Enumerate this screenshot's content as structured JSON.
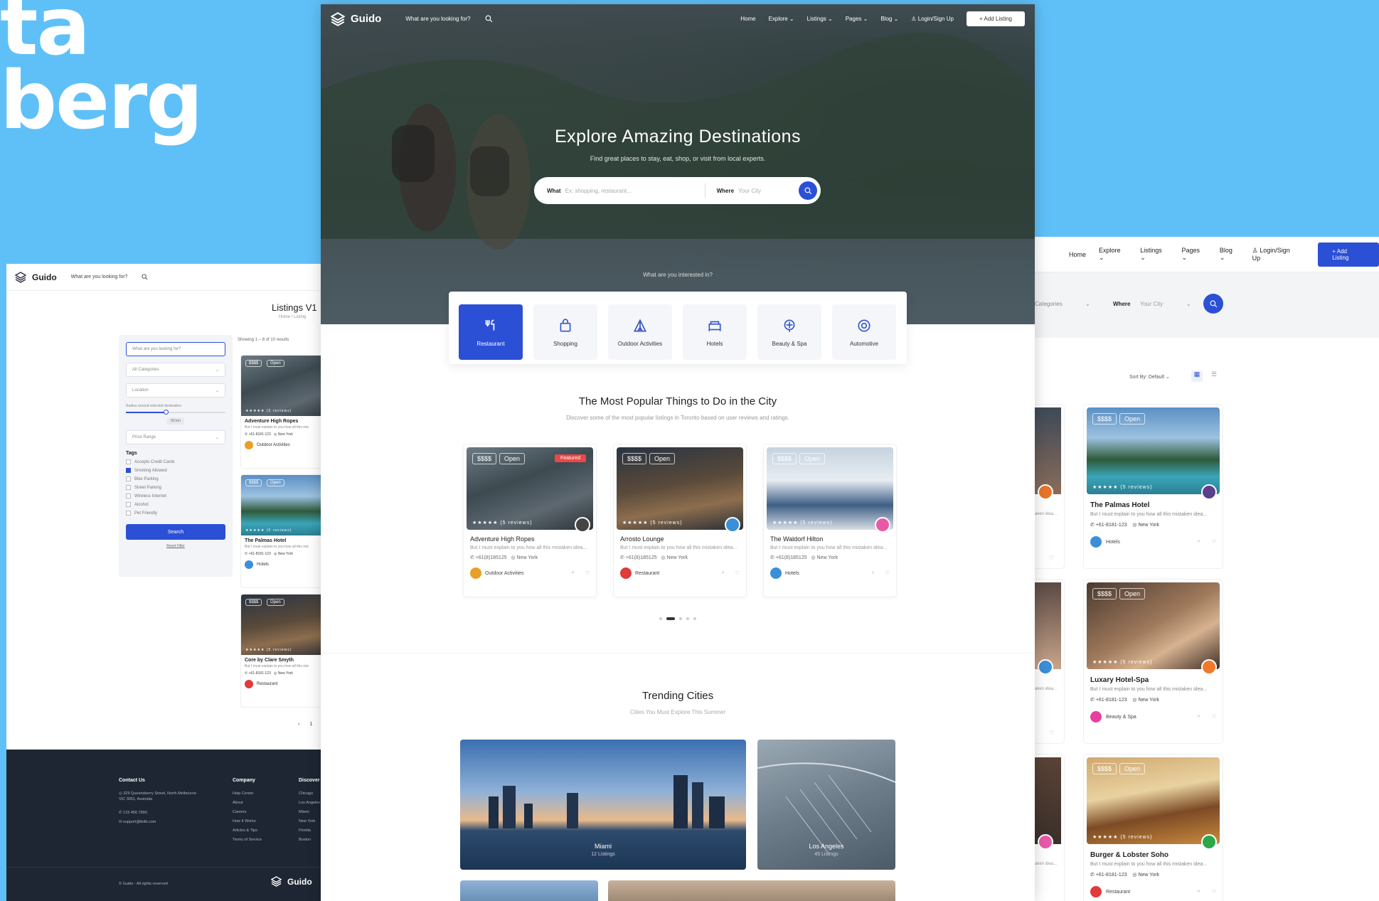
{
  "brand": "Guido",
  "bg_text": {
    "line1": "ta",
    "line2": "berg"
  },
  "colors": {
    "accent": "#2b50d6",
    "background": "#5fc0f8",
    "featured": "#e94848",
    "footer": "#1e2633"
  },
  "center": {
    "search_hint": "What are you looking for?",
    "nav": [
      "Home",
      "Explore",
      "Listings",
      "Pages",
      "Blog"
    ],
    "login": "Login/Sign Up",
    "add_listing": "+ Add Listing",
    "hero_title": "Explore Amazing Destinations",
    "hero_sub": "Find great places to stay, eat, shop, or visit from local experts.",
    "what_label": "What",
    "what_placeholder": "Ex: shopping, restaurant...",
    "where_label": "Where",
    "where_placeholder": "Your City",
    "interest": "What are you interested in?",
    "categories": [
      {
        "label": "Restaurant",
        "icon": "fork-knife-icon"
      },
      {
        "label": "Shopping",
        "icon": "shopping-bag-icon"
      },
      {
        "label": "Outdoor Activities",
        "icon": "tent-icon"
      },
      {
        "label": "Hotels",
        "icon": "hotel-icon"
      },
      {
        "label": "Beauty & Spa",
        "icon": "spa-icon"
      },
      {
        "label": "Automotive",
        "icon": "car-icon"
      }
    ],
    "popular_title": "The Most Popular Things to Do in the City",
    "popular_sub": "Discover some of the most popular listings in Toronto based on user reviews and ratings.",
    "popular": [
      {
        "title": "Adventure High Ropes",
        "desc": "But I must explain to you how all this mistaken idea...",
        "phone": "+61(8)185125",
        "city": "New York",
        "category": "Outdoor Activities",
        "price": "$$$$",
        "status": "Open",
        "featured": "Featured",
        "reviews": "(5 reviews)"
      },
      {
        "title": "Arrosto Lounge",
        "desc": "But I must explain to you how all this mistaken idea...",
        "phone": "+61(8)185125",
        "city": "New York",
        "category": "Restaurant",
        "price": "$$$$",
        "status": "Open",
        "reviews": "(5 reviews)"
      },
      {
        "title": "The Waldorf Hilton",
        "desc": "But I must explain to you how all this mistaken idea...",
        "phone": "+61(8)185125",
        "city": "New York",
        "category": "Hotels",
        "price": "$$$$",
        "status": "Open",
        "reviews": "(5 reviews)"
      }
    ],
    "trending_title": "Trending Cities",
    "trending_sub": "Cities You Must Explore This Summer",
    "cities": [
      {
        "name": "Miami",
        "count": "12 Listings"
      },
      {
        "name": "Los Angeles",
        "count": "45 Listings"
      }
    ]
  },
  "left": {
    "title": "Listings V1",
    "crumb": "Home / Listing",
    "filter_search": "What are you looking for?",
    "all_categories": "All Categories",
    "location": "Location",
    "radius_label": "Radius around selected destination",
    "radius_value": "50 km",
    "price_range": "Price Range",
    "tags_title": "Tags",
    "tags": [
      {
        "label": "Accepts Credit Cards",
        "on": false
      },
      {
        "label": "Smoking Allowed",
        "on": true
      },
      {
        "label": "Bike Parking",
        "on": false
      },
      {
        "label": "Street Parking",
        "on": false
      },
      {
        "label": "Wireless Internet",
        "on": false
      },
      {
        "label": "Alcohol",
        "on": false
      },
      {
        "label": "Pet Friendly",
        "on": false
      }
    ],
    "search_btn": "Search",
    "reset": "Reset Filter",
    "results": "Showing 1 – 8 of 10 results",
    "cards": [
      {
        "title": "Adventure High Ropes",
        "desc": "But I must explain to you how all this mis",
        "phone": "+61-8181-123",
        "city": "New York",
        "category": "Outdoor Activities",
        "price": "$$$$",
        "status": "Open",
        "reviews": "(5 reviews)"
      },
      {
        "title": "The Palmas Hotel",
        "desc": "But I must explain to you how all this mis",
        "phone": "+61-8181-123",
        "city": "New York",
        "category": "Hotels",
        "price": "$$$$",
        "status": "Open",
        "reviews": "(5 reviews)"
      },
      {
        "title": "Core by Clare Smyth",
        "desc": "But I must explain to you how all this mis",
        "phone": "+61-8181-123",
        "city": "New York",
        "category": "Restaurant",
        "price": "$$$$",
        "status": "Open",
        "reviews": "(5 reviews)"
      }
    ],
    "pager": [
      "‹",
      "1"
    ],
    "footer": {
      "contact_title": "Contact Us",
      "address": "329 Queensberry Street, North Melbourne VIC 3051, Australia",
      "phone": "123 456 7890",
      "email": "support@ibdb.com",
      "company_title": "Company",
      "company": [
        "Help Center",
        "About",
        "Careers",
        "How It Works",
        "Articles & Tips",
        "Terms of Service"
      ],
      "discover_title": "Discover",
      "discover": [
        "Chicago",
        "Los Angeles",
        "Miami",
        "New York",
        "Florida",
        "Boston"
      ],
      "copy": "© Guido - All rights reserved"
    }
  },
  "right": {
    "nav": [
      "Home",
      "Explore",
      "Listings",
      "Pages",
      "Blog"
    ],
    "login": "Login/Sign Up",
    "add": "+ Add Listing",
    "categories": "Categories",
    "where": "Where",
    "city": "Your City",
    "sort": "Sort By: Default",
    "cards": [
      {
        "title": "The Palmas Hotel",
        "desc": "But I must explain to you how all this mistaken idea...",
        "phone": "+61-8181-123",
        "city": "New York",
        "category": "Hotels",
        "price": "$$$$",
        "status": "Open",
        "reviews": "(5 reviews)"
      },
      {
        "title": "Luxary Hotel-Spa",
        "desc": "But I must explain to you how all this mistaken idea...",
        "phone": "+61-8181-123",
        "city": "New York",
        "category": "Beauty & Spa",
        "price": "$$$$",
        "status": "Open",
        "reviews": "(5 reviews)"
      },
      {
        "title": "Burger & Lobster Soho",
        "desc": "But I must explain to you how all this mistaken idea...",
        "phone": "+61-8181-123",
        "city": "New York",
        "category": "Restaurant",
        "price": "$$$$",
        "status": "Open",
        "reviews": "(5 reviews)"
      }
    ],
    "stub_text": "aken idea..."
  }
}
